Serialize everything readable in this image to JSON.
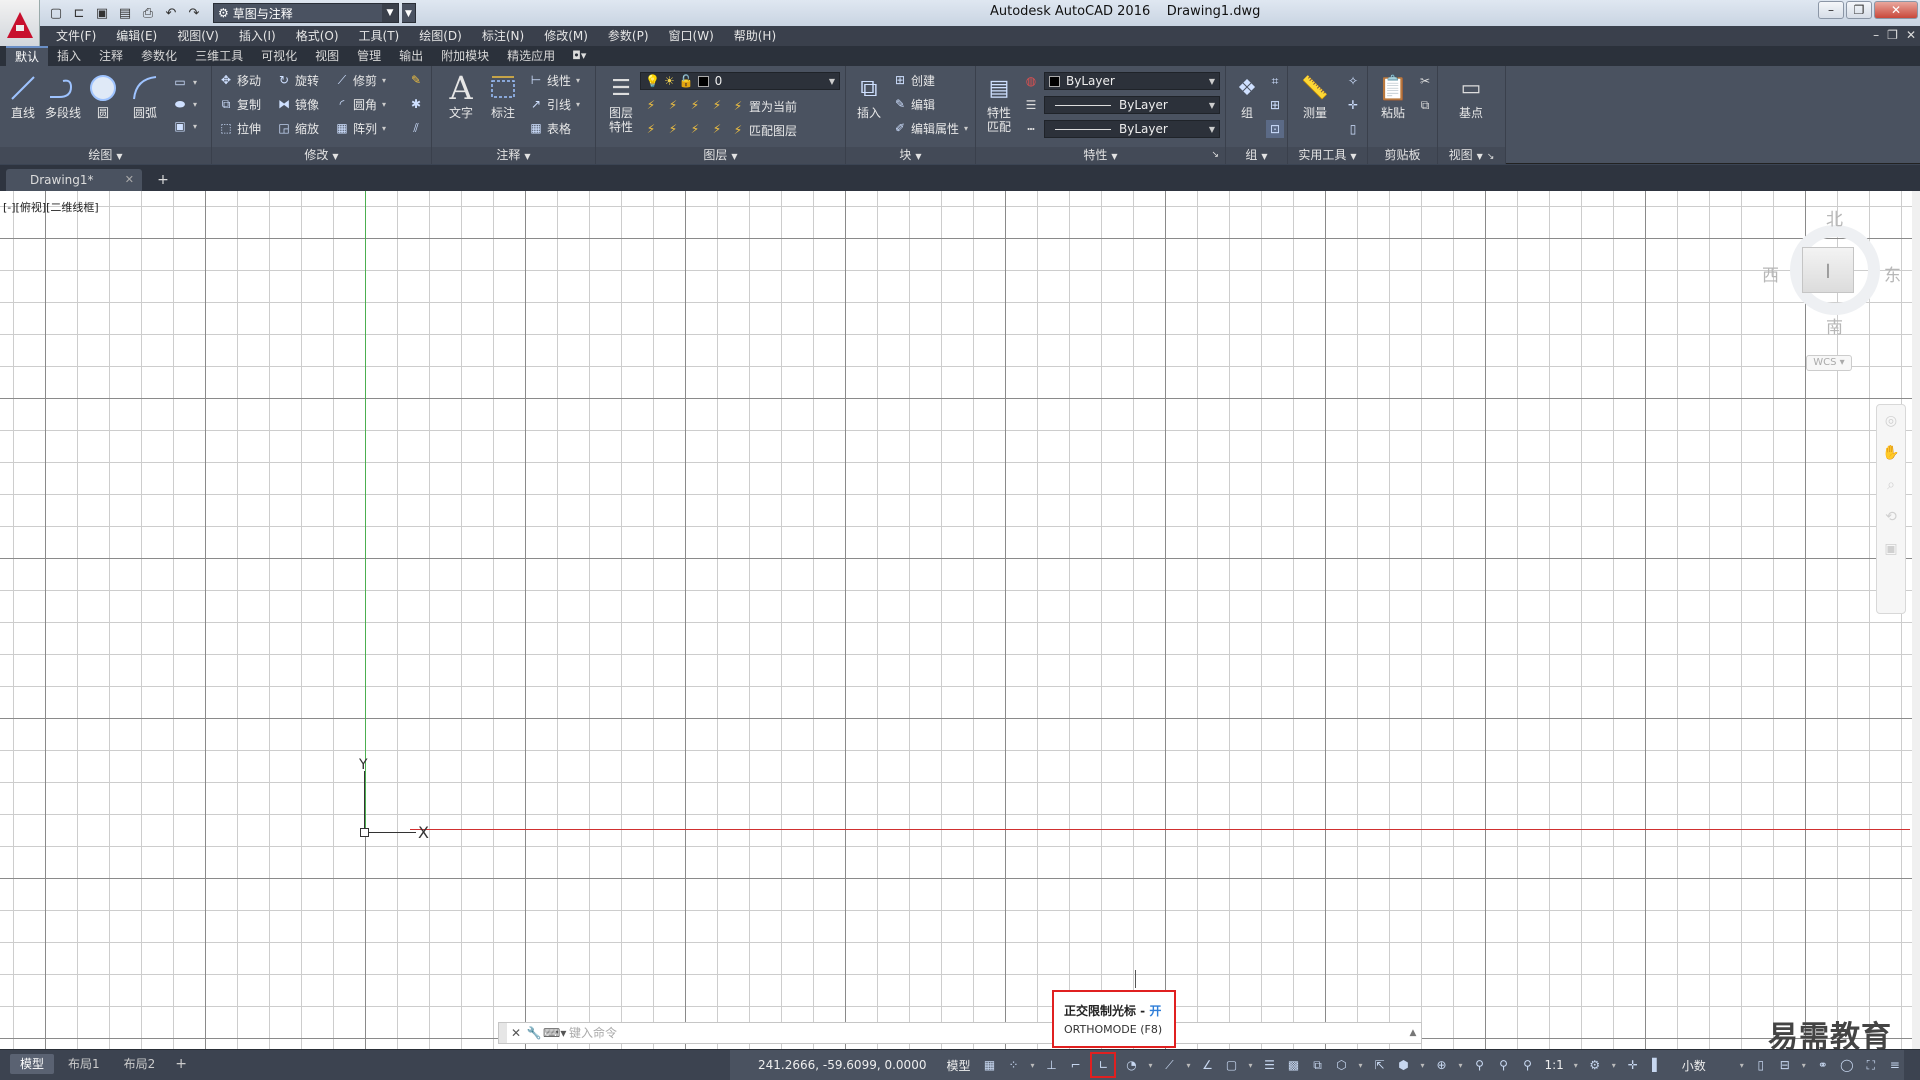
{
  "window": {
    "title": "Autodesk AutoCAD 2016    Drawing1.dwg",
    "workspace": "草图与注释"
  },
  "menu": [
    "文件(F)",
    "编辑(E)",
    "视图(V)",
    "插入(I)",
    "格式(O)",
    "工具(T)",
    "绘图(D)",
    "标注(N)",
    "修改(M)",
    "参数(P)",
    "窗口(W)",
    "帮助(H)"
  ],
  "ribbon_tabs": [
    "默认",
    "插入",
    "注释",
    "参数化",
    "三维工具",
    "可视化",
    "视图",
    "管理",
    "输出",
    "附加模块",
    "精选应用"
  ],
  "panels": {
    "draw": {
      "title": "绘图",
      "line": "直线",
      "polyline": "多段线",
      "circle": "圆",
      "arc": "圆弧"
    },
    "modify": {
      "title": "修改",
      "move": "移动",
      "rotate": "旋转",
      "trim": "修剪",
      "copy": "复制",
      "mirror": "镜像",
      "fillet": "圆角",
      "stretch": "拉伸",
      "scale": "缩放",
      "array": "阵列"
    },
    "annotation": {
      "title": "注释",
      "text": "文字",
      "dimension": "标注",
      "linear": "线性",
      "leader": "引线",
      "table": "表格"
    },
    "layers": {
      "title": "图层",
      "layer_props": "图层\n特性",
      "current_layer": "0",
      "set_current": "置为当前",
      "match_layer": "匹配图层"
    },
    "block": {
      "title": "块",
      "insert": "插入",
      "create": "创建",
      "edit": "编辑",
      "edit_attr": "编辑属性"
    },
    "properties": {
      "title": "特性",
      "match": "特性\n匹配",
      "color": "ByLayer",
      "linetype": "ByLayer",
      "lineweight": "ByLayer"
    },
    "groups": {
      "title": "组",
      "group": "组"
    },
    "utilities": {
      "title": "实用工具",
      "measure": "测量"
    },
    "clipboard": {
      "title": "剪贴板",
      "paste": "粘贴"
    },
    "view": {
      "title": "视图",
      "base": "基点"
    }
  },
  "file_tab": "Drawing1*",
  "viewport_label": "[-][俯视][二维线框]",
  "ucs": {
    "x": "X",
    "y": "Y"
  },
  "viewcube": {
    "north": "北",
    "south": "南",
    "west": "西",
    "east": "东",
    "wcs": "WCS"
  },
  "command_line": {
    "placeholder": "键入命令"
  },
  "tooltip": {
    "title": "正交限制光标 - ",
    "state": "开",
    "subtitle": "ORTHOMODE (F8)"
  },
  "watermark": "易需教育",
  "status": {
    "layout_tabs": [
      "模型",
      "布局1",
      "布局2"
    ],
    "coords": "241.2666, -59.6099, 0.0000",
    "model": "模型",
    "scale": "1:1",
    "units": "小数"
  },
  "colors": {
    "accent": "#6a8fc7",
    "highlight": "#e02020",
    "tooltip_on": "#2f7ed8",
    "x_axis": "#d03030",
    "y_axis": "#4caf50"
  }
}
